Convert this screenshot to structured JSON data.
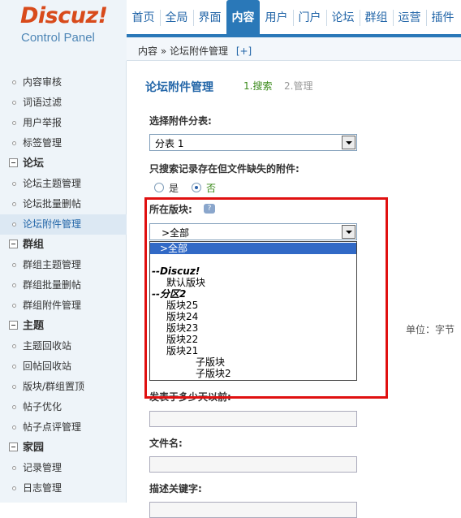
{
  "header": {
    "logo_main": "Discuz!",
    "logo_sub": "Control Panel",
    "nav": [
      {
        "label": "首页",
        "active": false
      },
      {
        "label": "全局",
        "active": false
      },
      {
        "label": "界面",
        "active": false
      },
      {
        "label": "内容",
        "active": true
      },
      {
        "label": "用户",
        "active": false
      },
      {
        "label": "门户",
        "active": false
      },
      {
        "label": "论坛",
        "active": false
      },
      {
        "label": "群组",
        "active": false
      },
      {
        "label": "运营",
        "active": false
      },
      {
        "label": "插件",
        "active": false
      }
    ],
    "breadcrumb": "内容 » 论坛附件管理",
    "breadcrumb_plus": "[+]"
  },
  "sidebar": {
    "items": [
      {
        "type": "item",
        "label": "内容审核"
      },
      {
        "type": "item",
        "label": "词语过滤"
      },
      {
        "type": "item",
        "label": "用户举报"
      },
      {
        "type": "item",
        "label": "标签管理"
      },
      {
        "type": "group",
        "label": "论坛"
      },
      {
        "type": "item",
        "label": "论坛主题管理"
      },
      {
        "type": "item",
        "label": "论坛批量删帖"
      },
      {
        "type": "item",
        "label": "论坛附件管理",
        "active": true
      },
      {
        "type": "group",
        "label": "群组"
      },
      {
        "type": "item",
        "label": "群组主题管理"
      },
      {
        "type": "item",
        "label": "群组批量删帖"
      },
      {
        "type": "item",
        "label": "群组附件管理"
      },
      {
        "type": "group",
        "label": "主题"
      },
      {
        "type": "item",
        "label": "主题回收站"
      },
      {
        "type": "item",
        "label": "回帖回收站"
      },
      {
        "type": "item",
        "label": "版块/群组置顶"
      },
      {
        "type": "item",
        "label": "帖子优化"
      },
      {
        "type": "item",
        "label": "帖子点评管理"
      },
      {
        "type": "group",
        "label": "家园"
      },
      {
        "type": "item",
        "label": "记录管理"
      },
      {
        "type": "item",
        "label": "日志管理"
      }
    ]
  },
  "main": {
    "title": "论坛附件管理",
    "step1": "1.搜索",
    "step2": "2.管理",
    "category_label": "选择附件分表:",
    "category_value": "分表 1",
    "missing_label": "只搜索记录存在但文件缺失的附件:",
    "radio_yes": "是",
    "radio_no": "否",
    "forum_label": "所在版块:",
    "forum_value": ">全部",
    "unit_text": "单位：字节",
    "days_label": "发表于多少天以前:",
    "filename_label": "文件名:",
    "keyword_label": "描述关键字:"
  },
  "dropdown": {
    "options": [
      {
        "label": ">全部",
        "selected": true,
        "group": false,
        "indent": 1
      },
      {
        "label": "",
        "selected": false,
        "group": false,
        "indent": 0
      },
      {
        "label": "--Discuz!",
        "selected": false,
        "group": true,
        "indent": 0
      },
      {
        "label": "默认版块",
        "selected": false,
        "group": false,
        "indent": 2
      },
      {
        "label": "--分区2",
        "selected": false,
        "group": true,
        "indent": 0
      },
      {
        "label": "版块25",
        "selected": false,
        "group": false,
        "indent": 2
      },
      {
        "label": "版块24",
        "selected": false,
        "group": false,
        "indent": 2
      },
      {
        "label": "版块23",
        "selected": false,
        "group": false,
        "indent": 2
      },
      {
        "label": "版块22",
        "selected": false,
        "group": false,
        "indent": 2
      },
      {
        "label": "版块21",
        "selected": false,
        "group": false,
        "indent": 2
      },
      {
        "label": "子版块",
        "selected": false,
        "group": false,
        "indent": 3
      },
      {
        "label": "子版块2",
        "selected": false,
        "group": false,
        "indent": 3
      }
    ]
  },
  "colors": {
    "accent": "#2a78b8",
    "logo": "#d84a1b",
    "highlight": "#e01010",
    "selected": "#3169c6"
  }
}
